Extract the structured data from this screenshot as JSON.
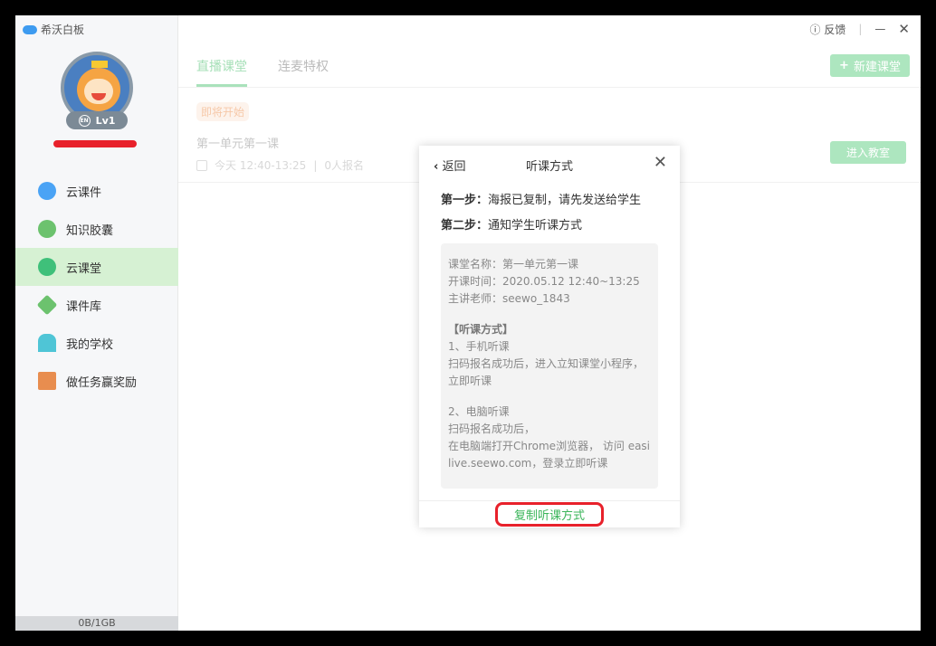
{
  "app": {
    "title": "希沃白板",
    "level": "Lv1",
    "level_badge": "EN",
    "storage": "0B/1GB"
  },
  "sidebar": {
    "items": [
      {
        "label": "云课件",
        "icon": "cloud-icon",
        "color": "#4aa3f5"
      },
      {
        "label": "知识胶囊",
        "icon": "capsule-icon",
        "color": "#6cc26e"
      },
      {
        "label": "云课堂",
        "icon": "play-circle-icon",
        "color": "#3fc07a",
        "active": true
      },
      {
        "label": "课件库",
        "icon": "library-icon",
        "color": "#6cc26e"
      },
      {
        "label": "我的学校",
        "icon": "school-icon",
        "color": "#4fc5d6"
      },
      {
        "label": "做任务赢奖励",
        "icon": "gift-icon",
        "color": "#e88d4f"
      }
    ]
  },
  "topbar": {
    "feedback": "反馈",
    "minimize": "—",
    "close": "✕"
  },
  "tabs": [
    {
      "label": "直播课堂",
      "active": true
    },
    {
      "label": "连麦特权"
    }
  ],
  "new_button": "新建课堂",
  "course": {
    "status": "即将开始",
    "title": "第一单元第一课",
    "time": "今天 12:40-13:25",
    "signups": "0人报名",
    "enter": "进入教室"
  },
  "dialog": {
    "back": "返回",
    "title": "听课方式",
    "close": "✕",
    "step1_label": "第一步：",
    "step1": "海报已复制，请先发送给学生",
    "step2_label": "第二步：",
    "step2": "通知学生听课方式",
    "info": [
      "课堂名称：第一单元第一课",
      "开课时间：2020.05.12 12:40~13:25",
      "主讲老师：seewo_1843"
    ],
    "method_heading": "【听课方式】",
    "mobile_title": "1、手机听课",
    "mobile_text": "扫码报名成功后，进入立知课堂小程序，立即听课",
    "pc_title": "2、电脑听课",
    "pc_text1": "扫码报名成功后，",
    "pc_text2": "在电脑端打开Chrome浏览器， 访问 easilive.seewo.com，登录立即听课",
    "copy_button": "复制听课方式"
  },
  "colors": {
    "accent": "#3bb55a",
    "highlight": "#e8212b"
  }
}
